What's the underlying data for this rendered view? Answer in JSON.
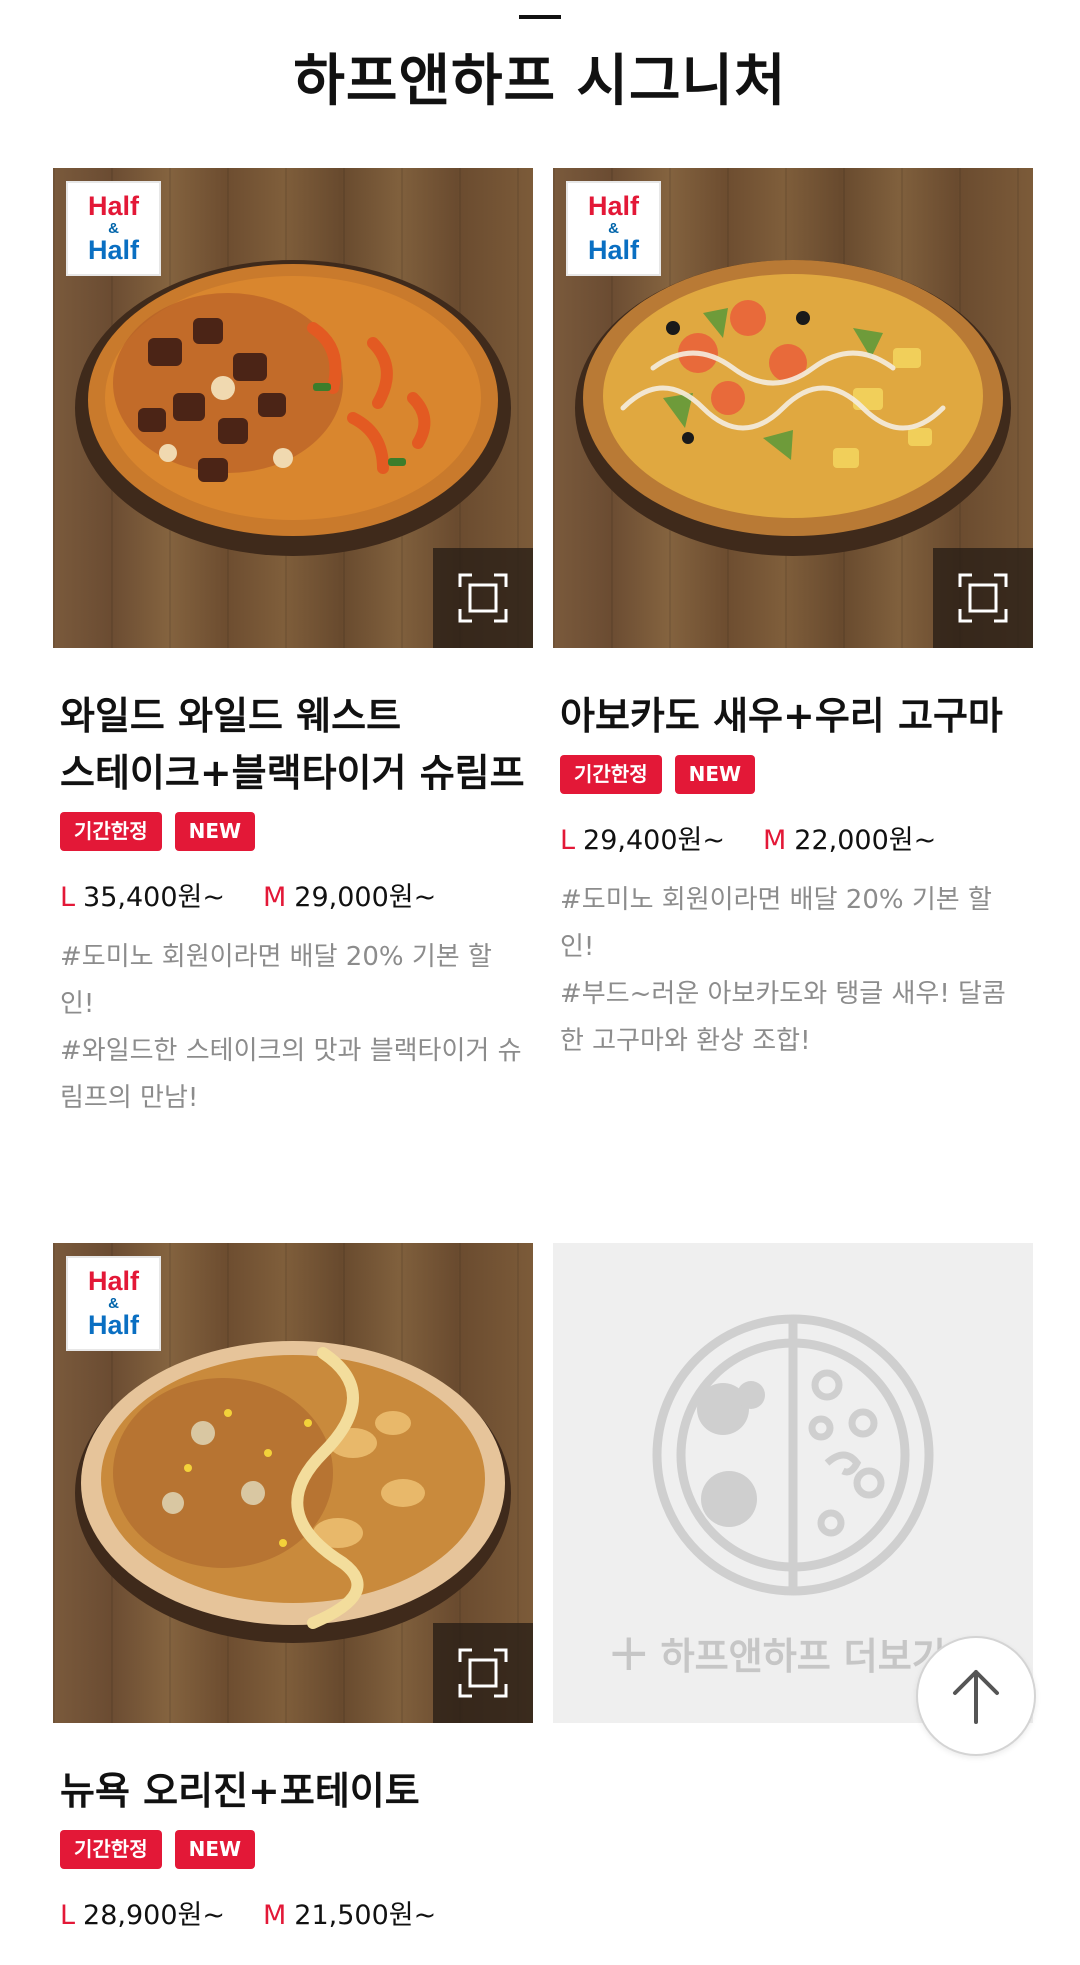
{
  "section": {
    "title": "하프앤하프 시그니처"
  },
  "badge": {
    "word1": "Half",
    "amp": "&",
    "word2": "Half"
  },
  "colors": {
    "accent": "#e31837",
    "badge_blue": "#0a6fc2",
    "desc_gray": "#8c8c8c"
  },
  "products": [
    {
      "name": "와일드 와일드 웨스트 스테이크+블랙타이거 슈림프",
      "tags": [
        "기간한정",
        "NEW"
      ],
      "price_l_size": "L",
      "price_l": "35,400원~",
      "price_m_size": "M",
      "price_m": "29,000원~",
      "description": "#도미노 회원이라면 배달 20% 기본 할인!\n#와일드한 스테이크의 맛과 블랙타이거 슈림프의 만남!",
      "zoom_icon": "expand-icon"
    },
    {
      "name": "아보카도 새우+우리 고구마",
      "tags": [
        "기간한정",
        "NEW"
      ],
      "price_l_size": "L",
      "price_l": "29,400원~",
      "price_m_size": "M",
      "price_m": "22,000원~",
      "description": "#도미노 회원이라면 배달 20% 기본 할인!\n#부드~러운 아보카도와 탱글 새우! 달콤한 고구마와 환상 조합!",
      "zoom_icon": "expand-icon"
    },
    {
      "name": "뉴욕 오리진+포테이토",
      "tags": [
        "기간한정",
        "NEW"
      ],
      "price_l_size": "L",
      "price_l": "28,900원~",
      "price_m_size": "M",
      "price_m": "21,500원~",
      "zoom_icon": "expand-icon"
    }
  ],
  "more_card": {
    "icon": "half-half-pizza-icon",
    "plus": "+",
    "label": "하프앤하프 더보기"
  },
  "top_button": {
    "icon": "arrow-up-icon"
  }
}
